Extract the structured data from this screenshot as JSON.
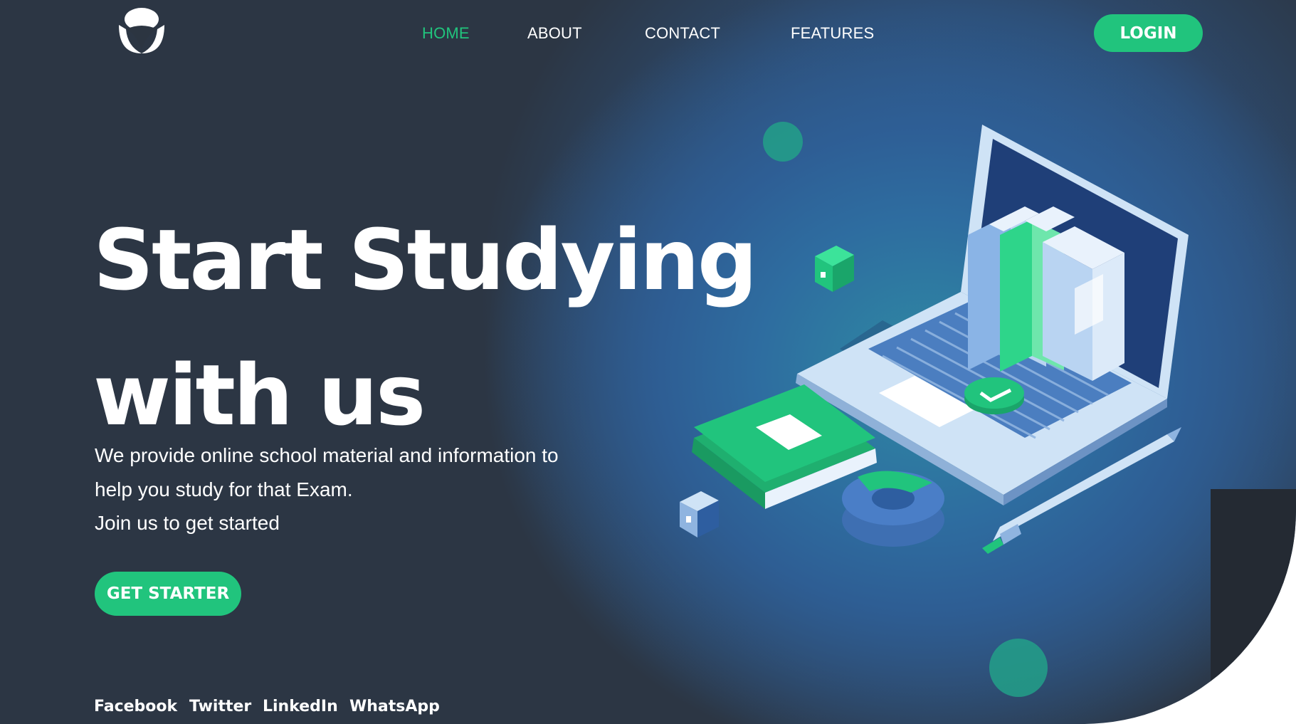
{
  "nav": {
    "logo_icon": "leaf-logo-icon",
    "items": [
      {
        "label": "HOME",
        "active": true
      },
      {
        "label": "ABOUT",
        "active": false
      },
      {
        "label": "CONTACT",
        "active": false
      },
      {
        "label": "FEATURES",
        "active": false
      }
    ],
    "login_label": "LOGIN"
  },
  "hero": {
    "headline_line1": "Start Studying",
    "headline_line2": "with us",
    "description_line1": "We provide online school material and information to",
    "description_line2": "help you study for that Exam.",
    "description_line3": "Join us to get started",
    "cta_label": "GET STARTER",
    "illustration_icon": "laptop-books-illustration"
  },
  "social": [
    "Facebook",
    "Twitter",
    "LinkedIn",
    "WhatsApp"
  ],
  "colors": {
    "accent": "#21c47d",
    "background_dark": "#2c3541",
    "background_blue": "#2e6da0",
    "text": "#ffffff"
  }
}
